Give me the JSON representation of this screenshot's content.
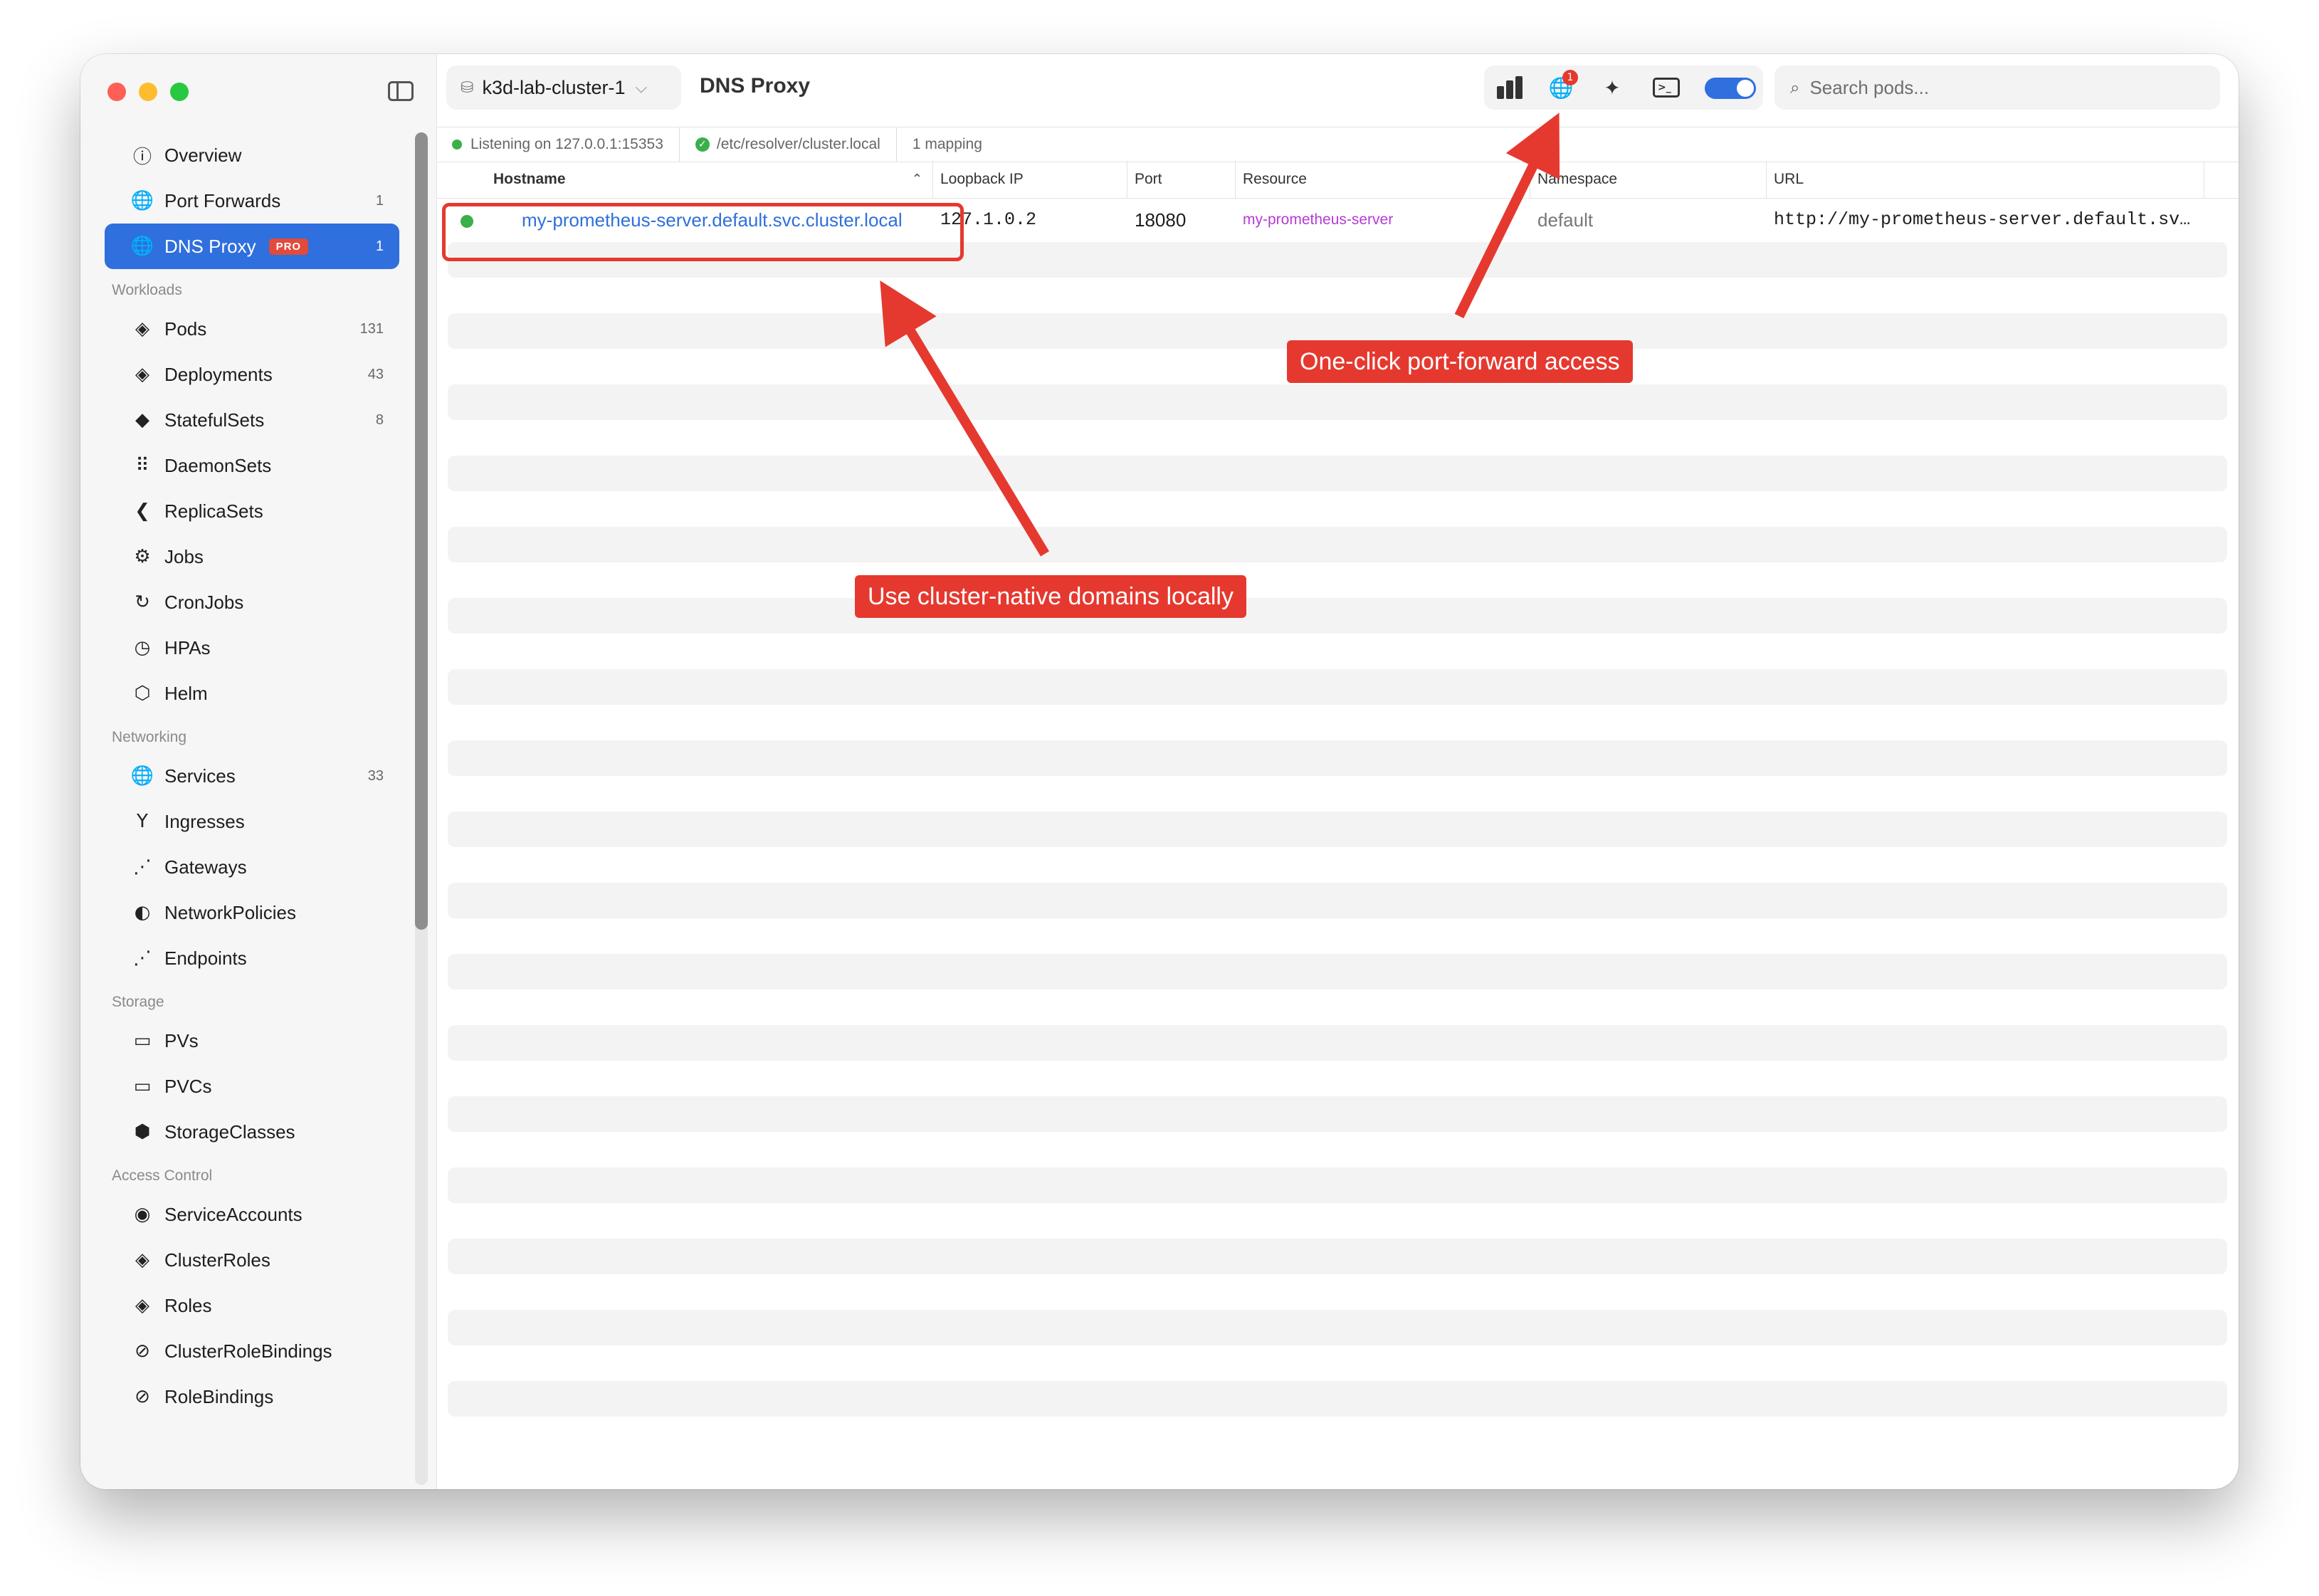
{
  "sidebar": {
    "items": [
      {
        "label": "Overview",
        "icon": "info-circle-icon",
        "glyph": "ⓘ",
        "count": ""
      },
      {
        "label": "Port Forwards",
        "icon": "globe-icon",
        "glyph": "🌐",
        "count": "1"
      },
      {
        "label": "DNS Proxy",
        "icon": "globe-icon",
        "glyph": "🌐",
        "count": "1",
        "badge": "PRO",
        "active": true
      }
    ],
    "sections": [
      {
        "title": "Workloads",
        "items": [
          {
            "label": "Pods",
            "icon": "layers-icon",
            "glyph": "◈",
            "count": "131"
          },
          {
            "label": "Deployments",
            "icon": "layers-icon",
            "glyph": "◈",
            "count": "43"
          },
          {
            "label": "StatefulSets",
            "icon": "stack-icon",
            "glyph": "◆",
            "count": "8"
          },
          {
            "label": "DaemonSets",
            "icon": "grid-dots-icon",
            "glyph": "⠿",
            "count": ""
          },
          {
            "label": "ReplicaSets",
            "icon": "replicas-icon",
            "glyph": "❮",
            "count": ""
          },
          {
            "label": "Jobs",
            "icon": "gears-icon",
            "glyph": "⚙",
            "count": ""
          },
          {
            "label": "CronJobs",
            "icon": "clock-arrow-icon",
            "glyph": "↻",
            "count": ""
          },
          {
            "label": "HPAs",
            "icon": "gauge-icon",
            "glyph": "◷",
            "count": ""
          },
          {
            "label": "Helm",
            "icon": "cube-icon",
            "glyph": "⬡",
            "count": ""
          }
        ]
      },
      {
        "title": "Networking",
        "items": [
          {
            "label": "Services",
            "icon": "globe-icon",
            "glyph": "🌐",
            "count": "33"
          },
          {
            "label": "Ingresses",
            "icon": "fork-icon",
            "glyph": "Y",
            "count": ""
          },
          {
            "label": "Gateways",
            "icon": "nodes-icon",
            "glyph": "⋰",
            "count": ""
          },
          {
            "label": "NetworkPolicies",
            "icon": "shield-icon",
            "glyph": "◐",
            "count": ""
          },
          {
            "label": "Endpoints",
            "icon": "nodes-icon",
            "glyph": "⋰",
            "count": ""
          }
        ]
      },
      {
        "title": "Storage",
        "items": [
          {
            "label": "PVs",
            "icon": "drive-icon",
            "glyph": "▭",
            "count": ""
          },
          {
            "label": "PVCs",
            "icon": "drive-link-icon",
            "glyph": "▭",
            "count": ""
          },
          {
            "label": "StorageClasses",
            "icon": "boxes-icon",
            "glyph": "⬢",
            "count": ""
          }
        ]
      },
      {
        "title": "Access Control",
        "items": [
          {
            "label": "ServiceAccounts",
            "icon": "person-circle-icon",
            "glyph": "◉",
            "count": ""
          },
          {
            "label": "ClusterRoles",
            "icon": "shield-icon",
            "glyph": "◈",
            "count": ""
          },
          {
            "label": "Roles",
            "icon": "shield-icon",
            "glyph": "◈",
            "count": ""
          },
          {
            "label": "ClusterRoleBindings",
            "icon": "link-circle-icon",
            "glyph": "⊘",
            "count": ""
          },
          {
            "label": "RoleBindings",
            "icon": "link-circle-icon",
            "glyph": "⊘",
            "count": ""
          }
        ]
      }
    ]
  },
  "header": {
    "cluster_name": "k3d-lab-cluster-1",
    "page_title": "DNS Proxy",
    "notification_count": "1",
    "search_placeholder": "Search pods..."
  },
  "status": {
    "listening": "Listening on 127.0.0.1:15353",
    "resolver": "/etc/resolver/cluster.local",
    "mappings": "1 mapping"
  },
  "table": {
    "columns": [
      "Hostname",
      "Loopback IP",
      "Port",
      "Resource",
      "Namespace",
      "URL"
    ],
    "rows": [
      {
        "hostname": "my-prometheus-server.default.svc.cluster.local",
        "loopback_ip": "127.1.0.2",
        "port": "18080",
        "resource": "my-prometheus-server",
        "namespace": "default",
        "url": "http://my-prometheus-server.default.sv…"
      }
    ]
  },
  "annotations": {
    "callout_toolbar": "One-click port-forward access",
    "callout_row": "Use cluster-native domains locally"
  },
  "colors": {
    "accent": "#2f6fde",
    "annotation_red": "#e5392f",
    "hostname_link": "#2f6fde",
    "resource_purple": "#b63ad6",
    "status_green": "#3aaf4a"
  }
}
